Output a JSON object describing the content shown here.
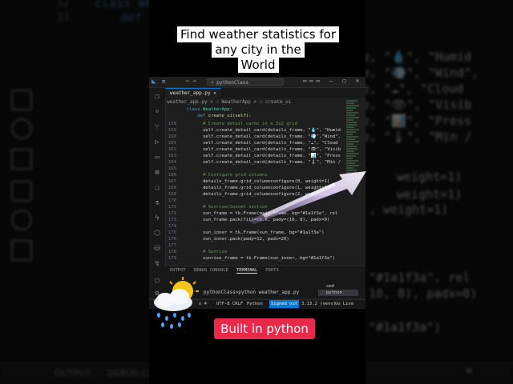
{
  "caption": {
    "line1": "Find weather statistics for",
    "line2": "any city in the",
    "line3": "World"
  },
  "badge": "Built in python",
  "background": {
    "top_lines": [
      {
        "num": "32",
        "text": "class Wea"
      },
      {
        "num": "33",
        "text": "def c"
      }
    ],
    "right_lines": [
      "e, \"💧\", \"Humid",
      "e, \"💨\", \"Wind\",",
      "e, \"☁\", \"Cloud",
      "e, \"👁\", \"Visib",
      "e, \"📊\", \"Press",
      "e, \"🌡\", \"Min /",
      "weight=1)",
      "weight=1)",
      ", weight=1)",
      "\"#1a1f3a\", rel",
      "10, 8), padx=0)",
      "\"#1a1f3a\")"
    ],
    "bottom_tabs": [
      "OUTPUT",
      "DEBUG CO"
    ]
  },
  "vscode": {
    "search": "pythonClass",
    "tab": "weather_app.py",
    "breadcrumb": "weather_app.py > ☉ WeatherApp > ☉ create_ui",
    "header_lines": [
      {
        "text_kw": "class ",
        "text_cls": "WeatherApp:"
      },
      {
        "text_kw": "def ",
        "text_fn": "create_ui(self):"
      }
    ],
    "lines": [
      {
        "n": "158",
        "t": "        # Create detail cards in a 3x2 grid",
        "c": "cm"
      },
      {
        "n": "159",
        "t": "        self.create_detail_card(details_frame, \"💧\", \"Humid",
        "c": ""
      },
      {
        "n": "160",
        "t": "        self.create_detail_card(details_frame, \"💨\",\"Wind\",",
        "c": ""
      },
      {
        "n": "161",
        "t": "        self.create_detail_card(details_frame, \"☁\", \"Cloud",
        "c": ""
      },
      {
        "n": "162",
        "t": "        self.create_detail_card(details_frame, \"👁\", \"Visib",
        "c": ""
      },
      {
        "n": "163",
        "t": "        self.create_detail_card(details_frame, \"📊\", \"Press",
        "c": ""
      },
      {
        "n": "164",
        "t": "        self.create_detail_card(details_frame, \"🌡\", \"Min /",
        "c": ""
      },
      {
        "n": "165",
        "t": "",
        "c": ""
      },
      {
        "n": "166",
        "t": "        # Configure grid columns",
        "c": "cm"
      },
      {
        "n": "167",
        "t": "        details_frame.grid_columnconfigure(0, weight=1)",
        "c": ""
      },
      {
        "n": "168",
        "t": "        details_frame.grid_columnconfigure(1, weight=1)",
        "c": ""
      },
      {
        "n": "169",
        "t": "        details_frame.grid_columnconfigure(2, weight=1)",
        "c": ""
      },
      {
        "n": "170",
        "t": "",
        "c": ""
      },
      {
        "n": "171",
        "t": "        # Sunrise/Sunset section",
        "c": "cm"
      },
      {
        "n": "172",
        "t": "        sun_frame = tk.Frame(main_frame, bg=\"#1a1f3a\", rel",
        "c": ""
      },
      {
        "n": "173",
        "t": "        sun_frame.pack(fill=tk.X, pady=(10, 8), padx=0)",
        "c": ""
      },
      {
        "n": "174",
        "t": "",
        "c": ""
      },
      {
        "n": "175",
        "t": "        sun_inner = tk.Frame(sun_frame, bg=\"#1a1f3a\")",
        "c": ""
      },
      {
        "n": "176",
        "t": "        sun_inner.pack(pady=12, padx=20)",
        "c": ""
      },
      {
        "n": "177",
        "t": "",
        "c": ""
      },
      {
        "n": "178",
        "t": "        # Sunrise",
        "c": "cm"
      },
      {
        "n": "179",
        "t": "        sunrise_frame = tk.Frame(sun_inner, bg=\"#1a1f3a\")",
        "c": ""
      }
    ],
    "panel_tabs": [
      "OUTPUT",
      "DEBUG CONSOLE",
      "TERMINAL",
      "PORTS"
    ],
    "active_panel_tab": "TERMINAL",
    "terminal_line": "pythonClass>python weather_app.py",
    "terminals": [
      "cmd",
      "python"
    ],
    "status": {
      "pos": "n 4",
      "enc": "UTF-8",
      "eol": "CRLF",
      "lang": "Python",
      "signed": "Signed out",
      "ver": "3.13.2 (venv)",
      "live": "Go Live"
    }
  }
}
